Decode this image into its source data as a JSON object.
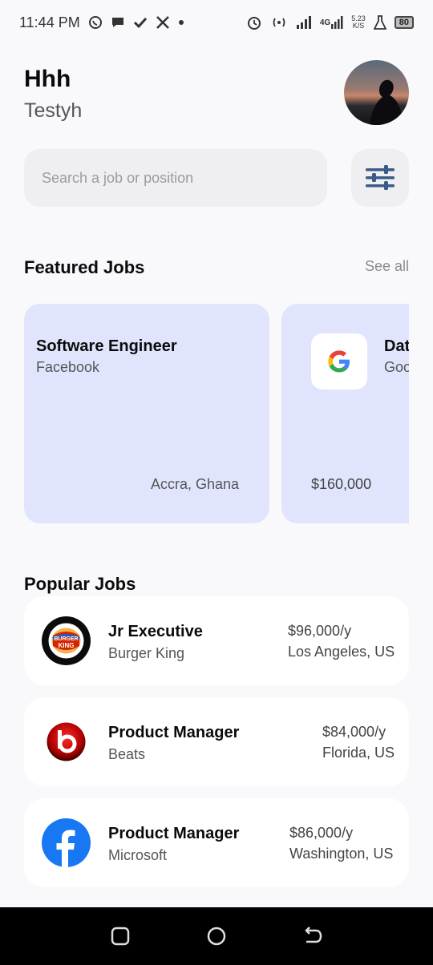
{
  "status_bar": {
    "time": "11:44 PM",
    "net_speed_value": "5.23",
    "net_speed_unit": "K/S",
    "network_type": "4G",
    "battery": "80"
  },
  "header": {
    "name": "Hhh",
    "subtitle": "Testyh"
  },
  "search": {
    "placeholder": "Search a job or position"
  },
  "featured": {
    "title": "Featured Jobs",
    "see_all": "See all",
    "cards": [
      {
        "title": "Software Engineer",
        "company": "Facebook",
        "location": "Accra, Ghana"
      },
      {
        "title": "Dat",
        "company": "Goo",
        "salary": "$160,000",
        "logo": "google-logo"
      }
    ]
  },
  "popular": {
    "title": "Popular Jobs",
    "jobs": [
      {
        "title": "Jr Executive",
        "company": "Burger King",
        "salary": "$96,000/y",
        "location": "Los Angeles, US",
        "logo": "burger-king-logo"
      },
      {
        "title": "Product Manager",
        "company": "Beats",
        "salary": "$84,000/y",
        "location": "Florida, US",
        "logo": "beats-logo"
      },
      {
        "title": "Product Manager",
        "company": "Microsoft",
        "salary": "$86,000/y",
        "location": "Washington, US",
        "logo": "facebook-logo"
      }
    ]
  },
  "colors": {
    "featured_card_bg": "#e0e5fd",
    "filter_icon": "#3b5a8a",
    "page_bg": "#f9f9fc"
  },
  "icons": {
    "status_left": [
      "whatsapp-icon",
      "chat-bubble-icon",
      "check-icon",
      "x-icon",
      "dot-icon"
    ],
    "status_right": [
      "alarm-icon",
      "hotspot-icon",
      "signal-icon",
      "signal-4g-icon",
      "flask-icon",
      "battery-icon"
    ],
    "filter": "sliders-icon",
    "nav": [
      "recent-apps-icon",
      "home-icon",
      "back-icon"
    ]
  }
}
